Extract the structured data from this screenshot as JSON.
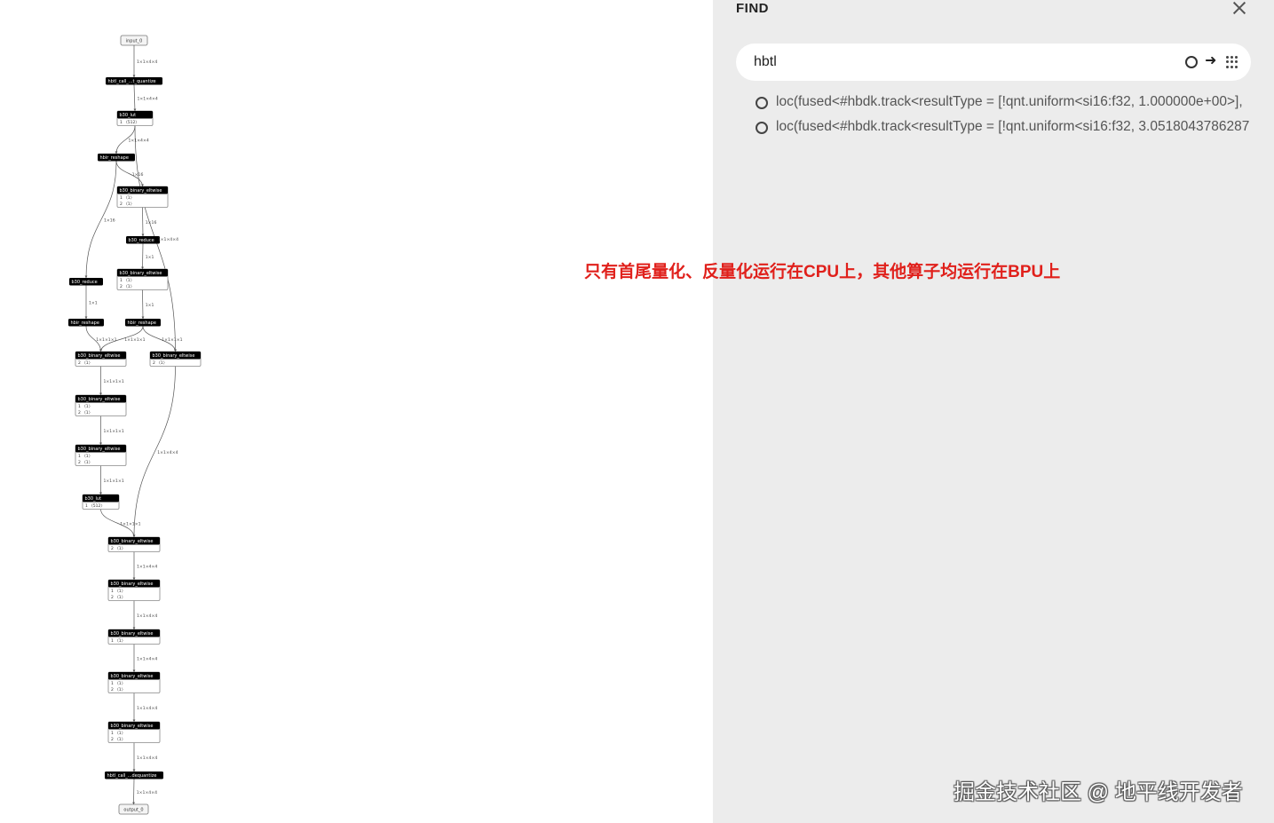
{
  "graph": {
    "nodes": [
      {
        "title": "input_0",
        "io": true,
        "attrs": []
      },
      {
        "title": "hbtl_call_...t_quantize",
        "attrs": []
      },
      {
        "title": "b30_lut",
        "attrs": [
          "1 〈512〉"
        ]
      },
      {
        "title": "hbir_reshape",
        "attrs": []
      },
      {
        "title": "b30_binary_eltwise",
        "attrs": [
          "1 〈1〉",
          "2 〈1〉"
        ]
      },
      {
        "title": "b30_reduce",
        "attrs": []
      },
      {
        "title": "b30_binary_eltwise",
        "attrs": [
          "1 〈1〉",
          "2 〈1〉"
        ]
      },
      {
        "title": "b30_reduce",
        "attrs": []
      },
      {
        "title": "hbir_reshape",
        "attrs": []
      },
      {
        "title": "hbir_reshape",
        "attrs": []
      },
      {
        "title": "b30_binary_eltwise",
        "attrs": [
          "2 〈1〉"
        ]
      },
      {
        "title": "b30_binary_eltwise",
        "attrs": [
          "2 〈1〉"
        ]
      },
      {
        "title": "b30_binary_eltwise",
        "attrs": [
          "1 〈1〉",
          "2 〈1〉"
        ]
      },
      {
        "title": "b30_binary_eltwise",
        "attrs": [
          "1 〈1〉",
          "2 〈1〉"
        ]
      },
      {
        "title": "b30_lut",
        "attrs": [
          "1 〈512〉"
        ]
      },
      {
        "title": "b30_binary_eltwise",
        "attrs": [
          "2 〈1〉"
        ]
      },
      {
        "title": "b30_binary_eltwise",
        "attrs": [
          "1 〈1〉",
          "2 〈1〉"
        ]
      },
      {
        "title": "b30_binary_eltwise",
        "attrs": [
          "1 〈1〉"
        ]
      },
      {
        "title": "b30_binary_eltwise",
        "attrs": [
          "1 〈1〉",
          "2 〈1〉"
        ]
      },
      {
        "title": "b30_binary_eltwise",
        "attrs": [
          "1 〈1〉",
          "2 〈1〉"
        ]
      },
      {
        "title": "hbtl_call_...dequantize",
        "attrs": []
      },
      {
        "title": "output_0",
        "io": true,
        "attrs": []
      }
    ],
    "edges": [
      {
        "from": 0,
        "to": 1,
        "label": "1×1×4×4"
      },
      {
        "from": 1,
        "to": 2,
        "label": "1×1×4×4"
      },
      {
        "from": 2,
        "to": 3,
        "label": "1×1×4×4"
      },
      {
        "from": 2,
        "to": 11,
        "label": "1×1×4×4"
      },
      {
        "from": 3,
        "to": 4,
        "label": "1×16"
      },
      {
        "from": 3,
        "to": 7,
        "label": "1×16"
      },
      {
        "from": 4,
        "to": 5,
        "label": "1×16"
      },
      {
        "from": 5,
        "to": 6,
        "label": "1×1"
      },
      {
        "from": 6,
        "to": 9,
        "label": "1×1"
      },
      {
        "from": 7,
        "to": 8,
        "label": "1×1"
      },
      {
        "from": 8,
        "to": 10,
        "label": "1×1×1×1"
      },
      {
        "from": 9,
        "to": 10,
        "label": "1×1×1×1"
      },
      {
        "from": 9,
        "to": 11,
        "label": "1×1×1×1"
      },
      {
        "from": 10,
        "to": 12,
        "label": "1×1×1×1"
      },
      {
        "from": 12,
        "to": 13,
        "label": "1×1×1×1"
      },
      {
        "from": 13,
        "to": 14,
        "label": "1×1×1×1"
      },
      {
        "from": 14,
        "to": 15,
        "label": "1×1×1×1"
      },
      {
        "from": 11,
        "to": 15,
        "label": "1×1×4×4"
      },
      {
        "from": 15,
        "to": 16,
        "label": "1×1×4×4"
      },
      {
        "from": 16,
        "to": 17,
        "label": "1×1×4×4"
      },
      {
        "from": 17,
        "to": 18,
        "label": "1×1×4×4"
      },
      {
        "from": 18,
        "to": 19,
        "label": "1×1×4×4"
      },
      {
        "from": 19,
        "to": 20,
        "label": "1×1×4×4"
      },
      {
        "from": 20,
        "to": 21,
        "label": "1×1×4×4"
      }
    ]
  },
  "find": {
    "title": "FIND",
    "query": "hbtl",
    "results": [
      "loc(fused<#hbdk.track<resultType = [!qnt.uniform<si16:f32, 1.000000e+00>],",
      "loc(fused<#hbdk.track<resultType = [!qnt.uniform<si16:f32, 3.0518043786287"
    ]
  },
  "annotation": "只有首尾量化、反量化运行在CPU上，其他算子均运行在BPU上",
  "watermark": "掘金技术社区 @ 地平线开发者",
  "colors": {
    "panel_bg": "#ececec",
    "node_header": "#000000",
    "annotation": "#e0201b"
  }
}
